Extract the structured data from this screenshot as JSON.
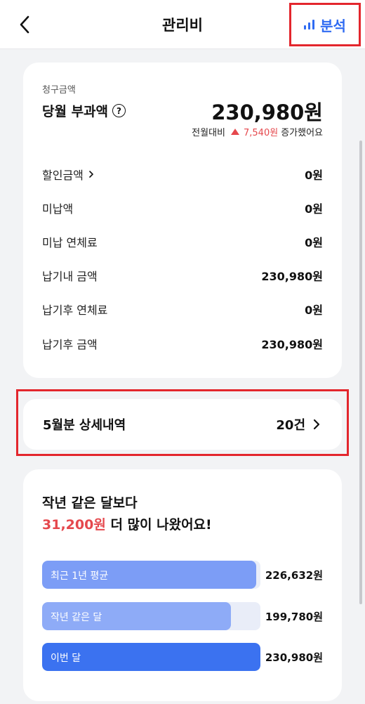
{
  "header": {
    "title": "관리비",
    "analysis_label": "분석"
  },
  "bill": {
    "caption": "청구금액",
    "main_label": "당월 부과액",
    "help_glyph": "?",
    "amount": "230,980원",
    "compare": {
      "prefix": "전월대비",
      "amount": "7,540원",
      "suffix": "증가했어요"
    },
    "rows": [
      {
        "label": "할인금액",
        "value": "0원"
      },
      {
        "label": "미납액",
        "value": "0원"
      },
      {
        "label": "미납 연체료",
        "value": "0원"
      },
      {
        "label": "납기내 금액",
        "value": "230,980원"
      },
      {
        "label": "납기후 연체료",
        "value": "0원"
      },
      {
        "label": "납기후 금액",
        "value": "230,980원"
      }
    ]
  },
  "detail": {
    "label": "5월분 상세내역",
    "count": "20건"
  },
  "comparison": {
    "headline_line1": "작년 같은 달보다",
    "headline_amount": "31,200원",
    "headline_rest": "더 많이 나왔어요!",
    "bars": [
      {
        "label": "최근 1년 평균",
        "value": "226,632원",
        "amount": 226632,
        "color": "#7c9df6"
      },
      {
        "label": "작년 같은 달",
        "value": "199,780원",
        "amount": 199780,
        "color": "#8eabf7"
      },
      {
        "label": "이번 달",
        "value": "230,980원",
        "amount": 230980,
        "color": "#3b72f0"
      }
    ]
  },
  "colors": {
    "accent": "#2f6bf2",
    "increase": "#e5484d",
    "highlight_box": "#e3262d"
  }
}
